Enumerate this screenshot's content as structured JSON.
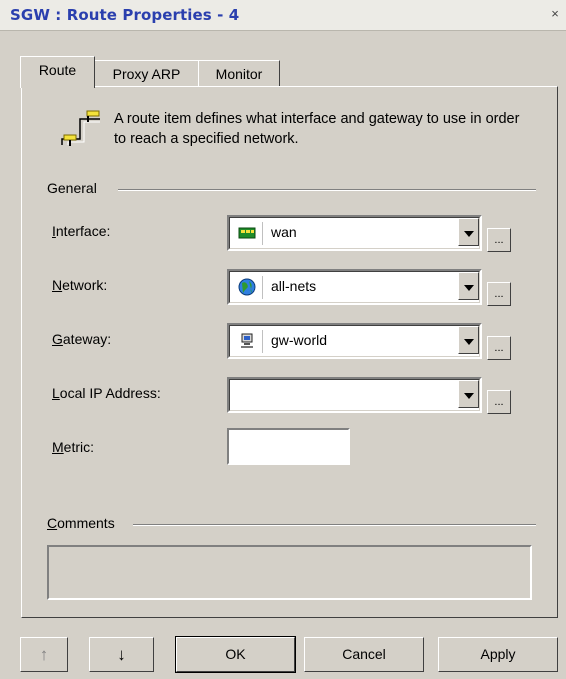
{
  "window": {
    "title": "SGW : Route Properties - 4",
    "close_glyph": "×"
  },
  "tabs": [
    "Route",
    "Proxy ARP",
    "Monitor"
  ],
  "route_tab": {
    "description": "A route item defines what interface and gateway to use in order to reach a specified network.",
    "general_label": "General",
    "interface": {
      "label": "Interface:",
      "value": "wan",
      "icon": "interface-icon"
    },
    "network": {
      "label": "Network:",
      "value": "all-nets",
      "icon": "globe-icon"
    },
    "gateway": {
      "label": "Gateway:",
      "value": "gw-world",
      "icon": "computer-icon"
    },
    "local_ip": {
      "label": "Local IP Address:",
      "value": ""
    },
    "metric": {
      "label": "Metric:",
      "value": ""
    },
    "comments_label": "Comments",
    "comments_value": "",
    "ellipsis": "..."
  },
  "buttons": {
    "up": "↑",
    "down": "↓",
    "ok": "OK",
    "cancel": "Cancel",
    "apply": "Apply"
  },
  "colors": {
    "title_text": "#2a3fae",
    "dialog_bg": "#d4d0c8"
  }
}
